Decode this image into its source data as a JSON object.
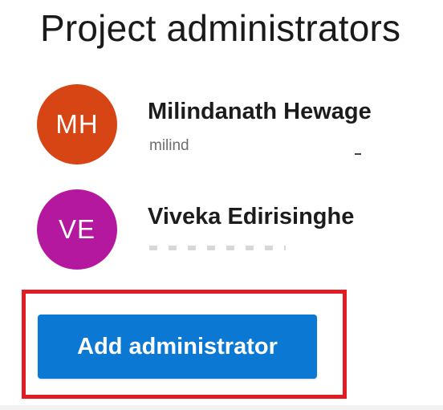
{
  "page": {
    "title": "Project administrators"
  },
  "administrators": [
    {
      "initials": "MH",
      "name": "Milindanath Hewage",
      "username": "milind",
      "avatar_color": "#d64513"
    },
    {
      "initials": "VE",
      "name": "Viveka Edirisinghe",
      "username": "",
      "avatar_color": "#b4189f"
    }
  ],
  "actions": {
    "add_label": "Add administrator",
    "button_color": "#0b78d4",
    "highlight_color": "#e11d23"
  }
}
